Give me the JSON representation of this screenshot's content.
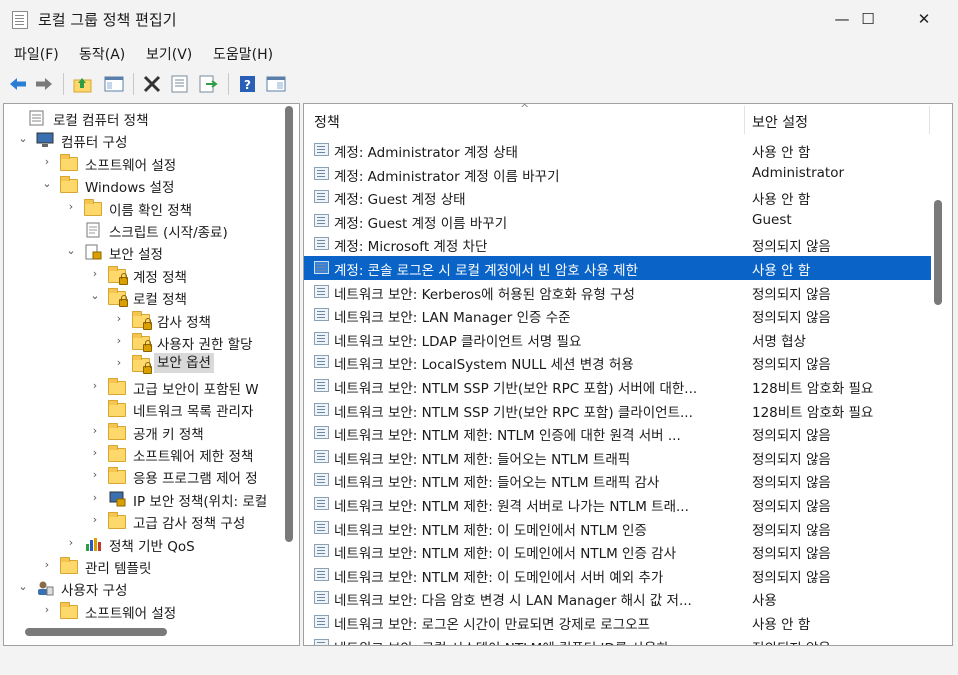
{
  "window": {
    "title": "로컬 그룹 정책 편집기",
    "min": "—",
    "max": "☐",
    "close": "✕"
  },
  "menu": [
    {
      "label": "파일(F)"
    },
    {
      "label": "동작(A)"
    },
    {
      "label": "보기(V)"
    },
    {
      "label": "도움말(H)"
    }
  ],
  "toolbar": {
    "buttons": [
      "back-arrow-icon",
      "forward-arrow-icon",
      "up-folder-icon",
      "show-hide-tree-icon",
      "delete-icon",
      "properties-icon",
      "export-list-icon",
      "help-icon",
      "show-pane-icon"
    ]
  },
  "tree": {
    "items": [
      {
        "label": "로컬 컴퓨터 정책",
        "level": 0,
        "expander": "",
        "icon": "policy"
      },
      {
        "label": "컴퓨터 구성",
        "level": 1,
        "expander": "⌄",
        "icon": "computer"
      },
      {
        "label": "소프트웨어 설정",
        "level": 2,
        "expander": "›",
        "icon": "folder"
      },
      {
        "label": "Windows 설정",
        "level": 2,
        "expander": "⌄",
        "icon": "folder"
      },
      {
        "label": "이름 확인 정책",
        "level": 3,
        "expander": "›",
        "icon": "folder"
      },
      {
        "label": "스크립트 (시작/종료)",
        "level": 3,
        "expander": "",
        "icon": "script"
      },
      {
        "label": "보안 설정",
        "level": 3,
        "expander": "⌄",
        "icon": "security"
      },
      {
        "label": "계정 정책",
        "level": 4,
        "expander": "›",
        "icon": "lockfolder"
      },
      {
        "label": "로컬 정책",
        "level": 4,
        "expander": "⌄",
        "icon": "lockfolder"
      },
      {
        "label": "감사 정책",
        "level": 5,
        "expander": "›",
        "icon": "lockfolder"
      },
      {
        "label": "사용자 권한 할당",
        "level": 5,
        "expander": "›",
        "icon": "lockfolder"
      },
      {
        "label": "보안 옵션",
        "level": 5,
        "expander": "›",
        "icon": "lockfolder",
        "selected": true
      },
      {
        "label": "고급 보안이 포함된 W",
        "level": 4,
        "expander": "›",
        "icon": "folder"
      },
      {
        "label": "네트워크 목록 관리자",
        "level": 4,
        "expander": "",
        "icon": "folder"
      },
      {
        "label": "공개 키 정책",
        "level": 4,
        "expander": "›",
        "icon": "folder"
      },
      {
        "label": "소프트웨어 제한 정책",
        "level": 4,
        "expander": "›",
        "icon": "folder"
      },
      {
        "label": "응용 프로그램 제어 정",
        "level": 4,
        "expander": "›",
        "icon": "folder"
      },
      {
        "label": "IP 보안 정책(위치: 로컬",
        "level": 4,
        "expander": "›",
        "icon": "ipsec"
      },
      {
        "label": "고급 감사 정책 구성",
        "level": 4,
        "expander": "›",
        "icon": "folder"
      },
      {
        "label": "정책 기반 QoS",
        "level": 3,
        "expander": "›",
        "icon": "qos"
      },
      {
        "label": "관리 템플릿",
        "level": 2,
        "expander": "›",
        "icon": "folder"
      },
      {
        "label": "사용자 구성",
        "level": 1,
        "expander": "⌄",
        "icon": "users"
      },
      {
        "label": "소프트웨어 설정",
        "level": 2,
        "expander": "›",
        "icon": "folder"
      }
    ]
  },
  "list": {
    "headers": {
      "policy": "정책",
      "setting": "보안 설정",
      "sort_glyph": "^"
    },
    "rows": [
      {
        "policy": "계정: Administrator 계정 상태",
        "setting": "사용 안 함"
      },
      {
        "policy": "계정: Administrator 계정 이름 바꾸기",
        "setting": "Administrator"
      },
      {
        "policy": "계정: Guest 계정 상태",
        "setting": "사용 안 함"
      },
      {
        "policy": "계정: Guest 계정 이름 바꾸기",
        "setting": "Guest"
      },
      {
        "policy": "계정: Microsoft 계정 차단",
        "setting": "정의되지 않음"
      },
      {
        "policy": "계정: 콘솔 로그온 시 로컬 계정에서 빈 암호 사용 제한",
        "setting": "사용 안 함",
        "selected": true
      },
      {
        "policy": "네트워크 보안: Kerberos에 허용된 암호화 유형 구성",
        "setting": "정의되지 않음"
      },
      {
        "policy": "네트워크 보안: LAN Manager 인증 수준",
        "setting": "정의되지 않음"
      },
      {
        "policy": "네트워크 보안: LDAP 클라이언트 서명 필요",
        "setting": "서명 협상"
      },
      {
        "policy": "네트워크 보안: LocalSystem NULL 세션 변경 허용",
        "setting": "정의되지 않음"
      },
      {
        "policy": "네트워크 보안: NTLM SSP 기반(보안 RPC 포함) 서버에 대한...",
        "setting": "128비트 암호화 필요"
      },
      {
        "policy": "네트워크 보안: NTLM SSP 기반(보안 RPC 포함) 클라이언트...",
        "setting": "128비트 암호화 필요"
      },
      {
        "policy": "네트워크 보안: NTLM 제한: NTLM 인증에 대한 원격 서버 ...",
        "setting": "정의되지 않음"
      },
      {
        "policy": "네트워크 보안: NTLM 제한: 들어오는 NTLM 트래픽",
        "setting": "정의되지 않음"
      },
      {
        "policy": "네트워크 보안: NTLM 제한: 들어오는 NTLM 트래픽 감사",
        "setting": "정의되지 않음"
      },
      {
        "policy": "네트워크 보안: NTLM 제한: 원격 서버로 나가는 NTLM 트래...",
        "setting": "정의되지 않음"
      },
      {
        "policy": "네트워크 보안: NTLM 제한: 이 도메인에서 NTLM 인증",
        "setting": "정의되지 않음"
      },
      {
        "policy": "네트워크 보안: NTLM 제한: 이 도메인에서 NTLM 인증 감사",
        "setting": "정의되지 않음"
      },
      {
        "policy": "네트워크 보안: NTLM 제한: 이 도메인에서 서버 예외 추가",
        "setting": "정의되지 않음"
      },
      {
        "policy": "네트워크 보안: 다음 암호 변경 시 LAN Manager 해시 값 저...",
        "setting": "사용"
      },
      {
        "policy": "네트워크 보안: 로그온 시간이 만료되면 강제로 로그오프",
        "setting": "사용 안 함"
      },
      {
        "policy": "네트워크 보안: 로컬 시스템이 NTLM에 컴퓨터 ID를 사용하...",
        "setting": "정의되지 않음"
      }
    ]
  },
  "colors": {
    "selection": "#0a64c8",
    "tree_selection": "#d9d9d9",
    "window_bg": "#f3f3f3"
  }
}
